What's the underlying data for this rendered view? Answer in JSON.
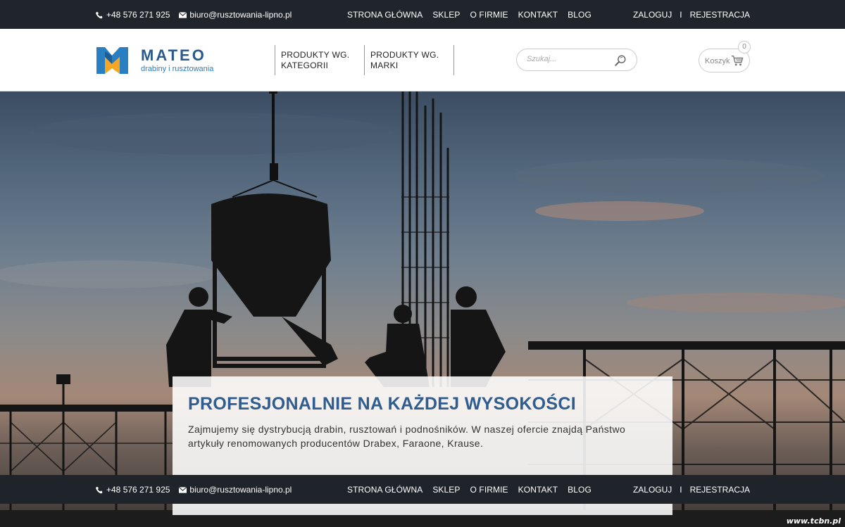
{
  "topbar": {
    "phone": "+48 576 271 925",
    "email": "biuro@rusztowania-lipno.pl",
    "nav": [
      "STRONA GŁÓWNA",
      "SKLEP",
      "O FIRMIE",
      "KONTAKT",
      "BLOG"
    ],
    "login": "ZALOGUJ",
    "separator": "I",
    "register": "REJESTRACJA"
  },
  "header": {
    "logo_name": "MATEO",
    "logo_tagline": "drabiny i rusztowania",
    "menu": [
      {
        "label": "PRODUKTY WG. KATEGORII"
      },
      {
        "label": "PRODUKTY WG. MARKI"
      }
    ],
    "search_placeholder": "Szukaj...",
    "cart_label": "Koszyk",
    "cart_count": "0"
  },
  "hero": {
    "title": "PROFESJONALNIE NA KAŻDEJ WYSOKOŚCI",
    "text": "Zajmujemy się dystrybucją drabin, rusztowań i podnośników. W naszej ofercie znajdą Państwo artykuły renomowanych producentów Drabex, Faraone, Krause."
  },
  "watermark": "www.tcbn.pl",
  "colors": {
    "bar_bg": "#20252b",
    "brand_blue": "#2f5d8f",
    "logo_orange": "#f5a623"
  },
  "icons": {
    "phone": "phone-icon",
    "email": "envelope-icon",
    "search": "magnifier-icon",
    "cart": "cart-icon"
  }
}
